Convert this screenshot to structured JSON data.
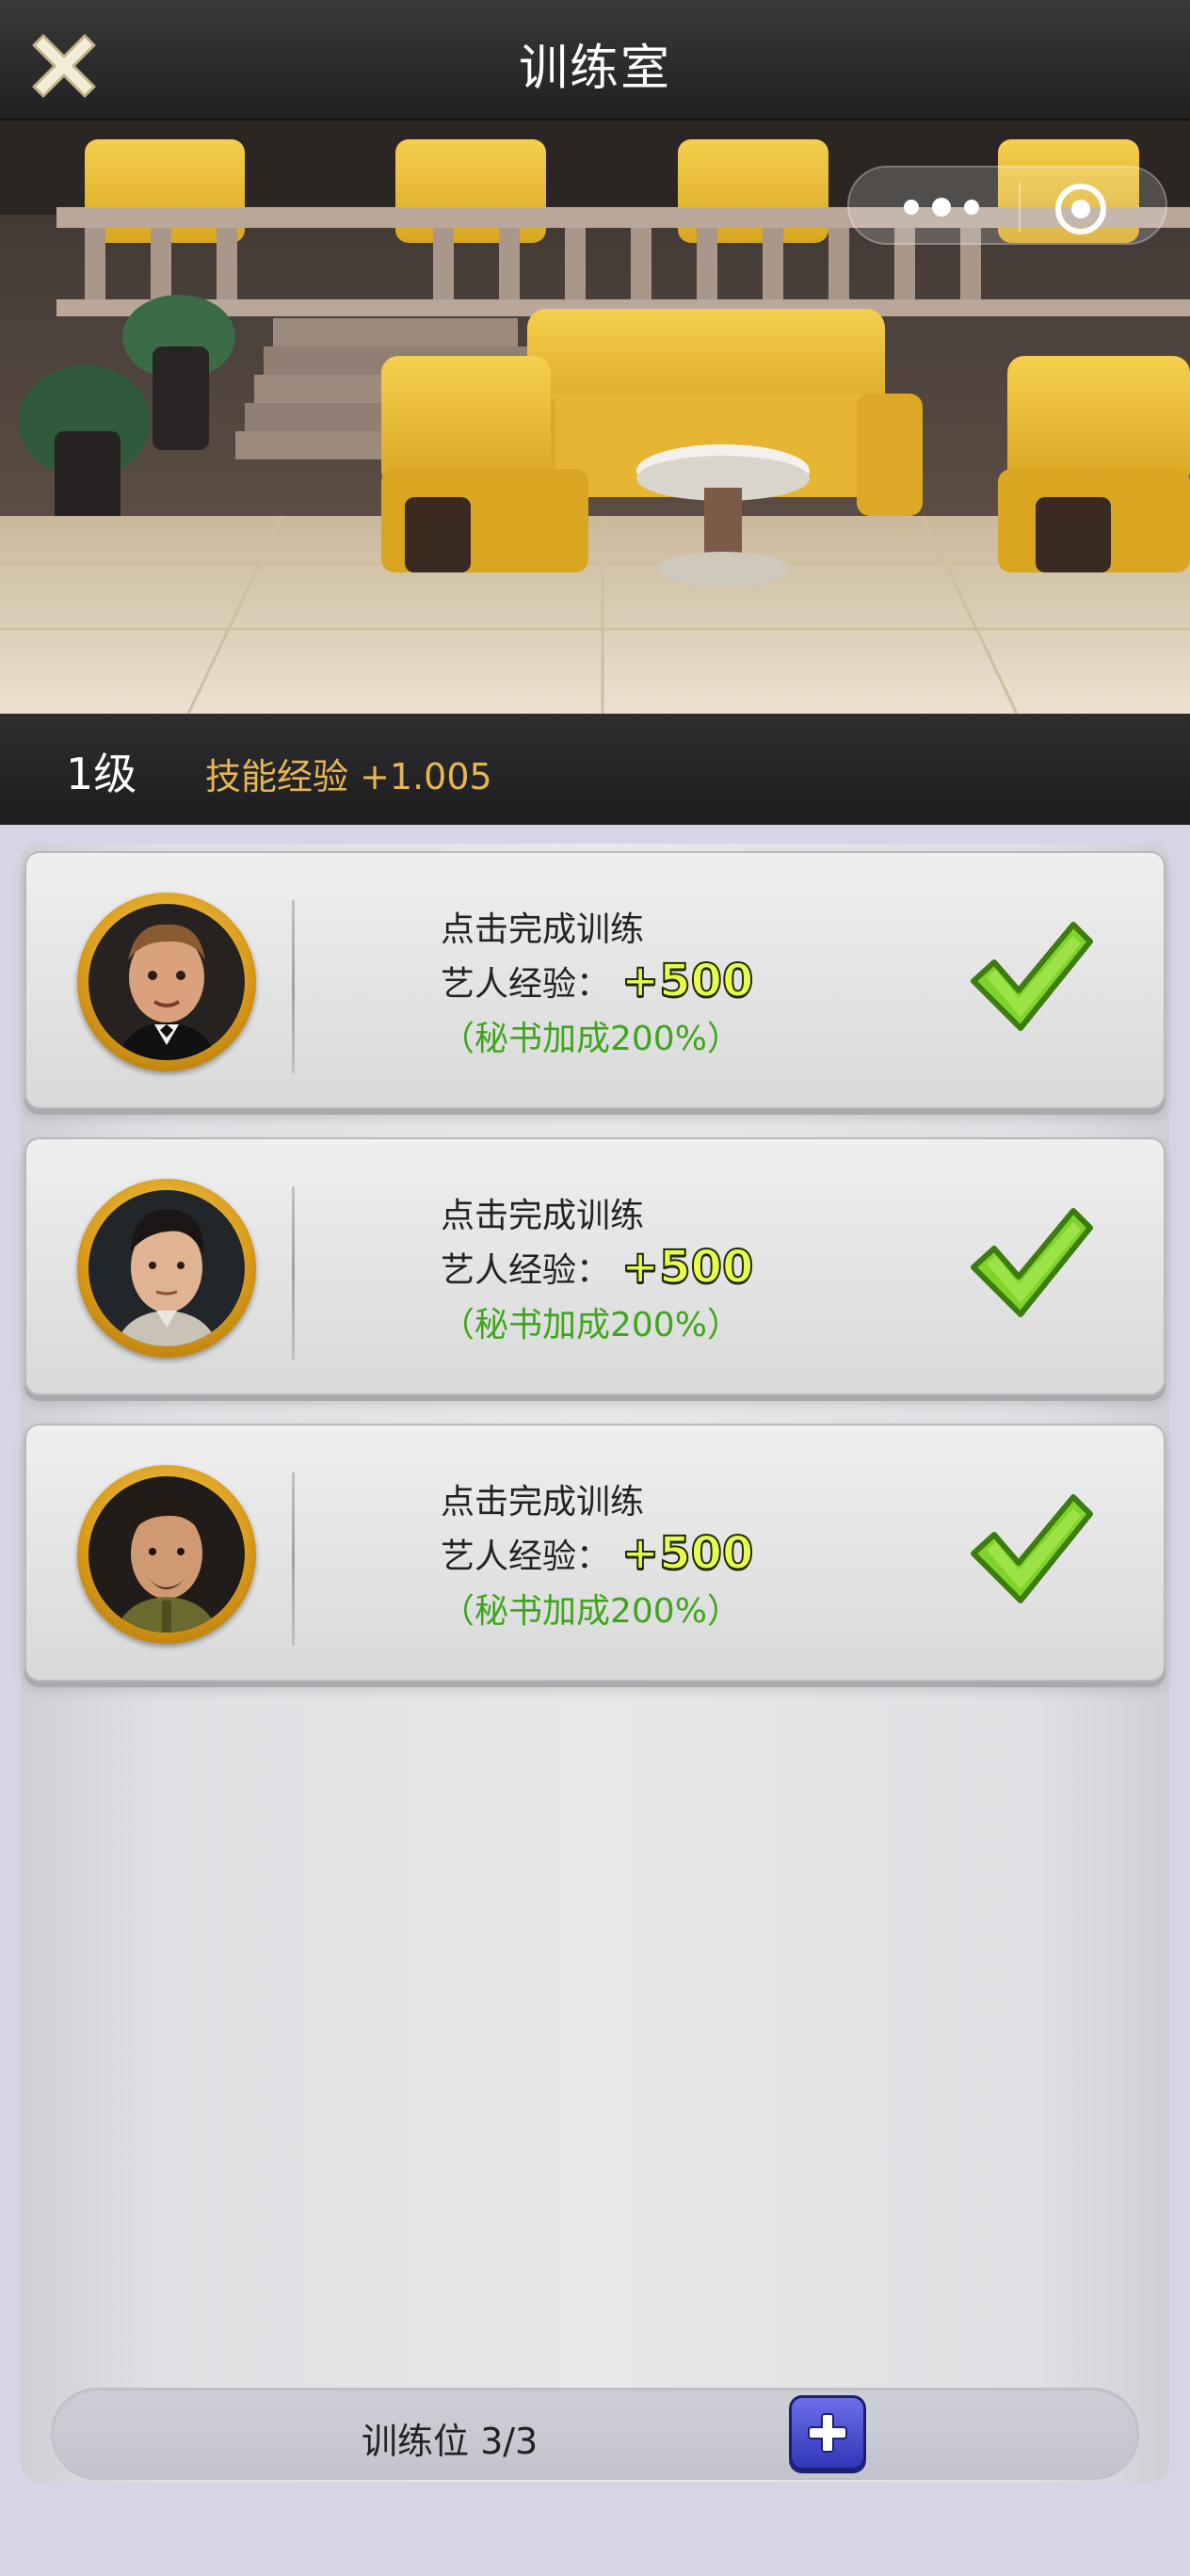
{
  "header": {
    "title": "训练室",
    "close_icon": "close-x-icon",
    "more_icon": "more-dots-icon",
    "target_icon": "target-circle-icon"
  },
  "level_bar": {
    "level": "1级",
    "skill_exp": "技能经验 +1.005"
  },
  "cards": [
    {
      "status": "点击完成训练",
      "exp_label": "艺人经验：",
      "exp_value": "+500",
      "bonus": "（秘书加成200%）",
      "avatar": "actor-avatar-1",
      "check_icon": "checkmark-icon"
    },
    {
      "status": "点击完成训练",
      "exp_label": "艺人经验：",
      "exp_value": "+500",
      "bonus": "（秘书加成200%）",
      "avatar": "actor-avatar-2",
      "check_icon": "checkmark-icon"
    },
    {
      "status": "点击完成训练",
      "exp_label": "艺人经验：",
      "exp_value": "+500",
      "bonus": "（秘书加成200%）",
      "avatar": "actor-avatar-3",
      "check_icon": "checkmark-icon"
    }
  ],
  "footer": {
    "slots": "训练位 3/3",
    "add_icon": "plus-icon"
  },
  "colors": {
    "skill_exp": "#e6b651",
    "bonus": "#3da61a",
    "exp_value": "#e9fd4c",
    "add_button": "#3036b8"
  }
}
